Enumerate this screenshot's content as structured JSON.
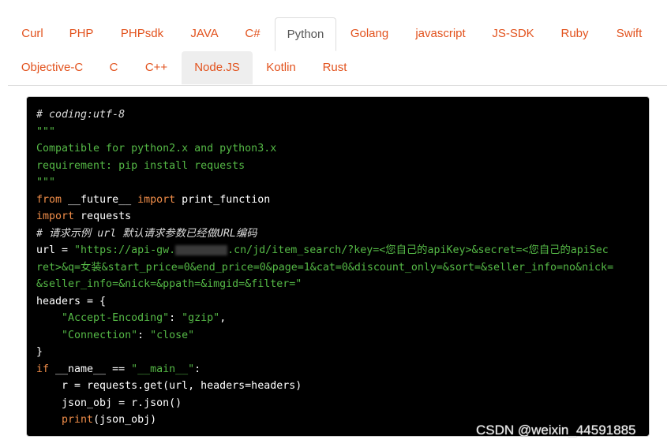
{
  "tabs_row1": [
    "Curl",
    "PHP",
    "PHPsdk",
    "JAVA",
    "C#",
    "Python",
    "Golang",
    "javascript",
    "JS-SDK",
    "Ruby",
    "Swift"
  ],
  "tabs_row2": [
    "Objective-C",
    "C",
    "C++",
    "Node.JS",
    "Kotlin",
    "Rust"
  ],
  "active_tab": "Python",
  "hovered_tab": "Node.JS",
  "code": {
    "l1": "# coding:utf-8",
    "l2": "\"\"\"",
    "l3": "Compatible for python2.x and python3.x",
    "l4": "requirement: pip install requests",
    "l5": "\"\"\"",
    "l6_kw1": "from",
    "l6_mid": " __future__ ",
    "l6_kw2": "import",
    "l6_end": " print_function",
    "l7_kw": "import",
    "l7_end": " requests",
    "l8": "# 请求示例 url 默认请求参数已经做URL编码",
    "l9_pre": "url = ",
    "l9_str1": "\"https://api-gw.",
    "l9_str2": ".cn/jd/item_search/?key=<您自己的apiKey>&secret=<您自己的apiSec",
    "l10": "ret>&q=女装&start_price=0&end_price=0&page=1&cat=0&discount_only=&sort=&seller_info=no&nick=",
    "l11": "&seller_info=&nick=&ppath=&imgid=&filter=\"",
    "l12": "headers = {",
    "l13_key": "\"Accept-Encoding\"",
    "l13_sep": ": ",
    "l13_val": "\"gzip\"",
    "l13_end": ",",
    "l14_key": "\"Connection\"",
    "l14_sep": ": ",
    "l14_val": "\"close\"",
    "l15": "}",
    "l16_kw": "if",
    "l16_mid": " __name__ == ",
    "l16_str": "\"__main__\"",
    "l16_end": ":",
    "l17": "    r = requests.get(url, headers=headers)",
    "l18": "    json_obj = r.json()",
    "l19_kw": "print",
    "l19_end": "(json_obj)"
  },
  "watermark": "CSDN @weixin_44591885",
  "colors": {
    "tab_text": "#e2521d",
    "code_bg": "#000000",
    "keyword": "#f08d49",
    "string": "#55b946"
  }
}
